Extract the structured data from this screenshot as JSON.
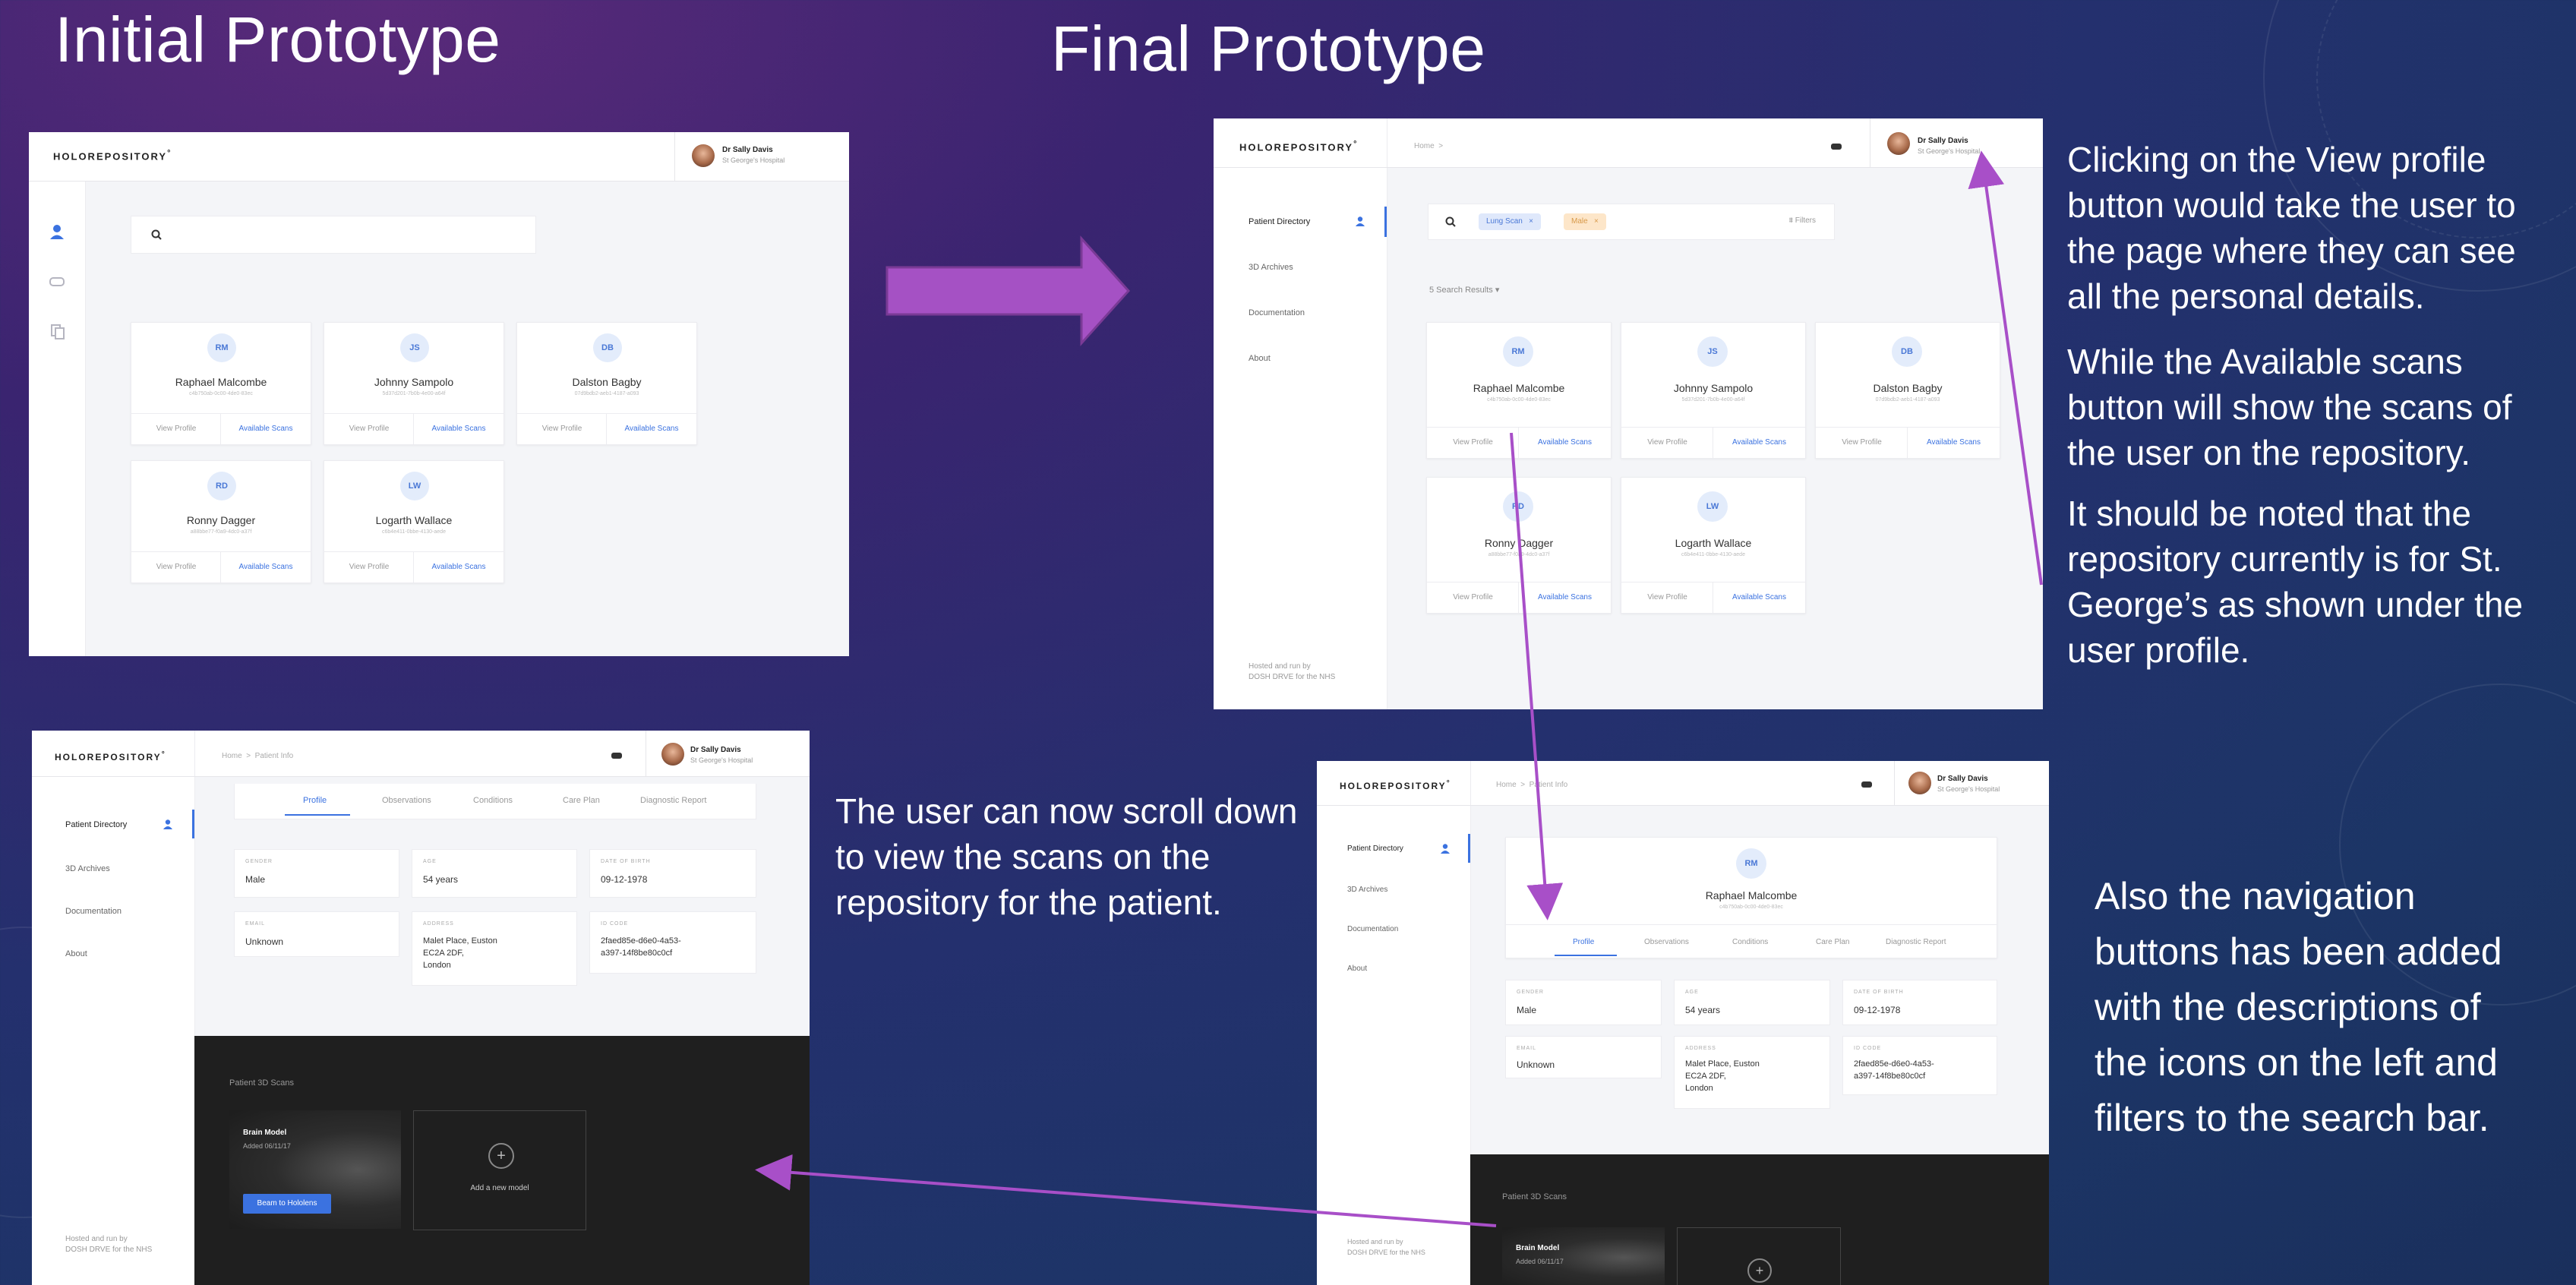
{
  "slide": {
    "heading_initial": "Initial Prototype",
    "heading_final": "Final Prototype",
    "caption_right_1": [
      "Clicking on the View profile",
      "button would take the user to",
      "the page where they can see",
      "all the personal details."
    ],
    "caption_right_2": [
      "While the Available scans",
      "button will show the scans of",
      "the user on the repository."
    ],
    "caption_right_3": [
      "It should be noted that the",
      "repository currently is for St.",
      "George’s as shown under the",
      "user profile."
    ],
    "caption_scroll": [
      "The user can now scroll down",
      "to view the scans on the",
      "repository for the patient."
    ],
    "caption_nav": [
      "Also the navigation",
      "buttons has been added",
      "with the descriptions of",
      "the icons on the left and",
      "filters to the search bar."
    ],
    "colors": {
      "arrow": "#a84fc8",
      "accent": "#3b72e0"
    }
  },
  "app": {
    "logo": "HOLOREPOSITORY",
    "logo_mark": "°",
    "user_name": "Dr Sally Davis",
    "user_hospital": "St George's Hospital",
    "breadcrumb_home": "Home",
    "breadcrumb_sep": ">",
    "breadcrumb_patient": "Patient Info",
    "nav": [
      "Patient Directory",
      "3D Archives",
      "Documentation",
      "About"
    ],
    "footer_line1": "Hosted and run by",
    "footer_line2": "DOSH DRVE for the NHS",
    "search_chips": [
      "Lung Scan",
      "Male"
    ],
    "chip_close": "×",
    "filters_label": "Filters",
    "results_label": "5 Search Results",
    "view_profile": "View Profile",
    "available_scans": "Available Scans",
    "patients": [
      {
        "initials": "RM",
        "name": "Raphael Malcombe",
        "id": "c4b750ab-0c00-4de0-83ec"
      },
      {
        "initials": "JS",
        "name": "Johnny Sampolo",
        "id": "5d37d201-7b0b-4e00-a64f"
      },
      {
        "initials": "DB",
        "name": "Dalston Bagby",
        "id": "07d9bdb2-aeb1-4187-a093"
      },
      {
        "initials": "RD",
        "name": "Ronny Dagger",
        "id": "a88bbe77-f0a9-4dc0-a37f"
      },
      {
        "initials": "LW",
        "name": "Logarth Wallace",
        "id": "c6b4e411-0bbe-4130-aede"
      }
    ],
    "tabs": [
      "Profile",
      "Observations",
      "Conditions",
      "Care Plan",
      "Diagnostic Report"
    ],
    "profile": {
      "gender_label": "GENDER",
      "gender": "Male",
      "age_label": "AGE",
      "age": "54 years",
      "dob_label": "DATE OF BIRTH",
      "dob": "09-12-1978",
      "email_label": "EMAIL",
      "email": "Unknown",
      "address_label": "ADDRESS",
      "address": [
        "Malet Place, Euston",
        "EC2A 2DF,",
        "London"
      ],
      "id_label": "ID CODE",
      "id_code": [
        "2faed85e-d6e0-4a53-",
        "a397-14f8be80c0cf"
      ],
      "patient_id_short": "c4b750ab-0c00-4de0-83ec"
    },
    "scans_heading": "Patient 3D Scans",
    "scan_title": "Brain Model",
    "scan_added": "Added 06/11/17",
    "beam_button": "Beam to Hololens",
    "add_model": "Add a new model",
    "plus": "+"
  }
}
